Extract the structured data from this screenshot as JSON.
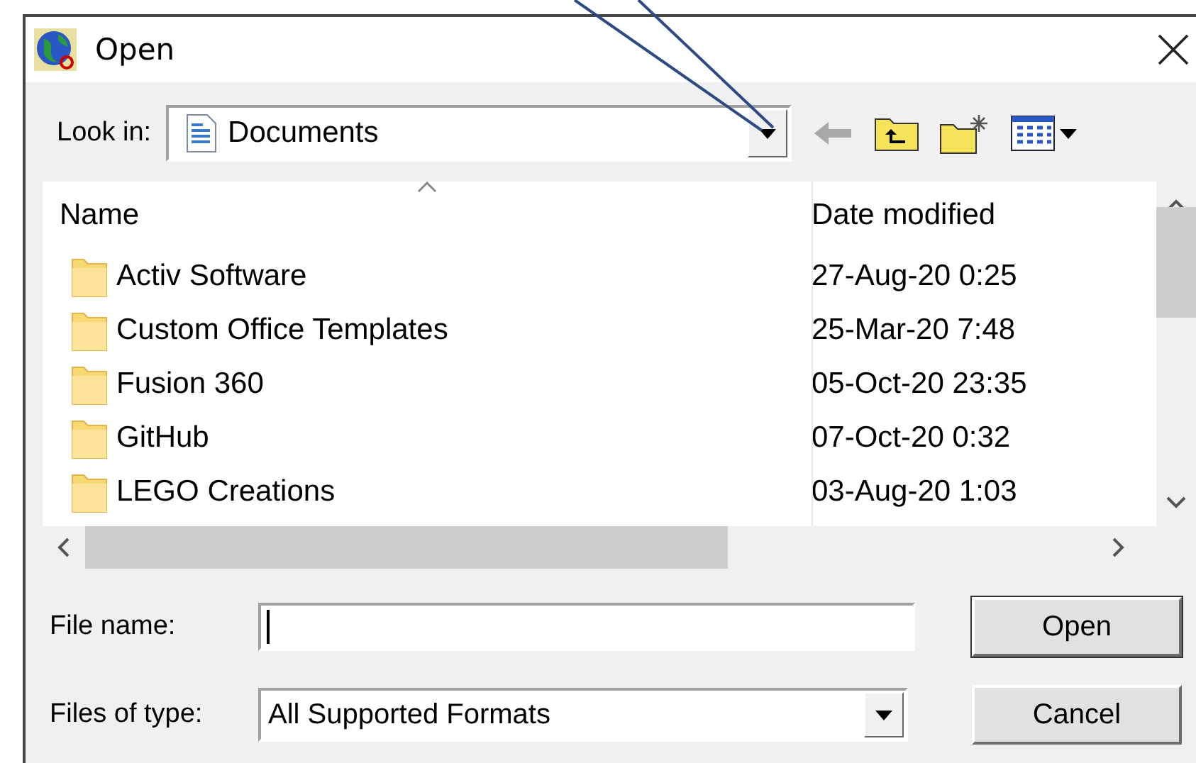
{
  "window": {
    "title": "Open"
  },
  "look_in": {
    "label": "Look in:",
    "value": "Documents"
  },
  "toolbar": {
    "back": {
      "disabled": true
    }
  },
  "file_list": {
    "columns": [
      {
        "label": "Name",
        "sorted": true
      },
      {
        "label": "Date modified",
        "sorted": false
      }
    ],
    "rows": [
      {
        "name": "Activ Software",
        "date": "27-Aug-20 0:25"
      },
      {
        "name": "Custom Office Templates",
        "date": "25-Mar-20 7:48"
      },
      {
        "name": "Fusion 360",
        "date": "05-Oct-20 23:35"
      },
      {
        "name": "GitHub",
        "date": "07-Oct-20 0:32"
      },
      {
        "name": "LEGO Creations",
        "date": "03-Aug-20 1:03"
      }
    ]
  },
  "file_name": {
    "label": "File name:"
  },
  "file_type": {
    "label": "Files of type:",
    "value": "All Supported Formats"
  },
  "buttons": [
    {
      "label": "Open",
      "default": true
    },
    {
      "label": "Cancel",
      "default": false
    }
  ]
}
